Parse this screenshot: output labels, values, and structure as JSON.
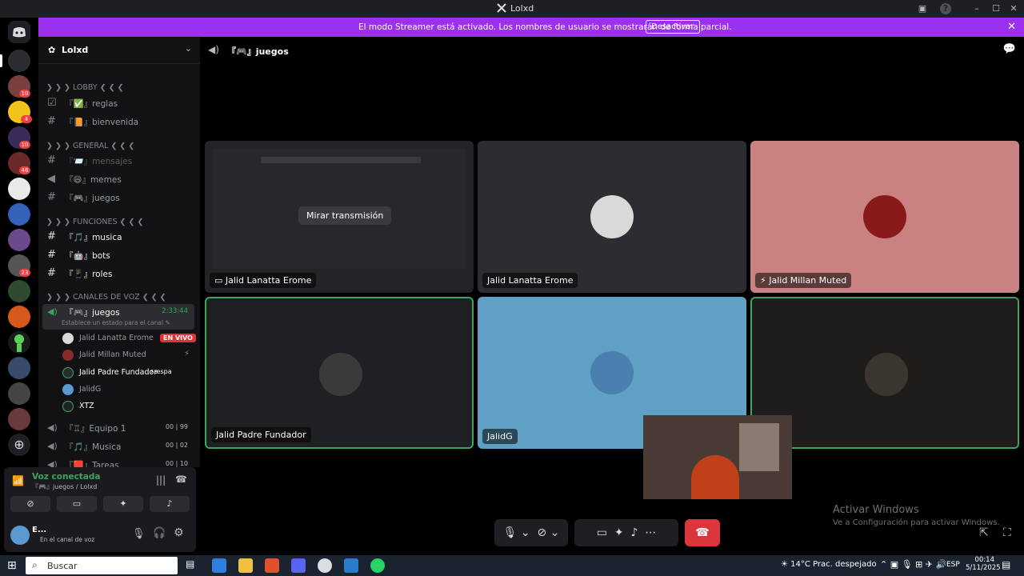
{
  "window": {
    "title": "Lolxd"
  },
  "banner": {
    "text": "El modo Streamer está activado. Los nombres de usuario se mostrarán de forma parcial.",
    "button": "Desactivar",
    "color": "#9b30ef"
  },
  "rail": {
    "badges": [
      "10",
      "4",
      "10",
      "46",
      "23"
    ]
  },
  "sidebar": {
    "server_name": "Lolxd",
    "categories": [
      {
        "label": "❯ ❯ ❯ LOBBY ❮ ❮ ❮"
      },
      {
        "label": "❯ ❯ ❯ GENERAL ❮ ❮ ❮"
      },
      {
        "label": "❯ ❯ ❯ FUNCIONES ❮ ❮ ❮"
      },
      {
        "label": "❯ ❯ ❯ CANALES DE VOZ ❮ ❮ ❮"
      }
    ],
    "channels": [
      {
        "label": "『✅』reglas"
      },
      {
        "label": "『📙』bienvenida"
      },
      {
        "label": "『📨』mensajes"
      },
      {
        "label": "『😄』memes"
      },
      {
        "label": "『🎮』juegos"
      },
      {
        "label": "『🎵』musica"
      },
      {
        "label": "『🤖』bots"
      },
      {
        "label": "『📱』roles"
      }
    ],
    "voice_channel": {
      "label": "『🎮』juegos",
      "timer": "2:33:44",
      "status": "Establece un estado para el canal ✎"
    },
    "voice_users": [
      {
        "name": "Jalid Lanatta Erome",
        "tag": "EN VIVO"
      },
      {
        "name": "Jalid Millan Muted"
      },
      {
        "name": "Jalid Padre Fundador",
        "tag": "⚡æspa"
      },
      {
        "name": "JalidG"
      },
      {
        "name": "XTZ"
      }
    ],
    "other_voice": [
      {
        "label": "『♖』Equipo 1",
        "count": "00 | 99"
      },
      {
        "label": "『🎵』Musica",
        "count": "00 | 02"
      },
      {
        "label": "『🟥』Tareas",
        "count": "00 | 10"
      }
    ]
  },
  "voice_panel": {
    "status": "Voz conectada",
    "location": "『🎮』juegos / Lolxd"
  },
  "user_panel": {
    "name": "E...",
    "status": "En el canal de voz"
  },
  "main": {
    "channel_title": "『🎮』juegos",
    "tiles": [
      {
        "name": "Jalid Lanatta Erome",
        "overlay": "Mirar transmisión"
      },
      {
        "name": "Jalid Lanatta Erome"
      },
      {
        "name": "Jalid Millan Muted"
      },
      {
        "name": "Jalid Padre Fundador"
      },
      {
        "name": "JalidG"
      },
      {
        "name": ""
      }
    ]
  },
  "watermark": {
    "title": "Activar Windows",
    "subtitle": "Ve a Configuración para activar Windows."
  },
  "taskbar": {
    "search": "Buscar",
    "weather": "14°C  Prac. despejado",
    "lang": "ESP",
    "time": "00:14",
    "date": "5/11/2025"
  }
}
